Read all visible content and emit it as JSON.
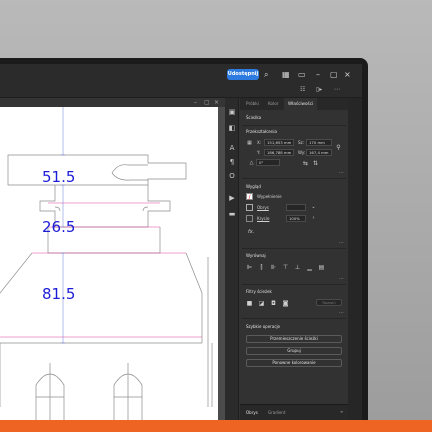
{
  "topbar": {
    "share_label": "Udostępnij",
    "search_icon": "search-icon",
    "layout_icon": "workspace-icon"
  },
  "panel": {
    "tabs": [
      "Próbki",
      "Kolor",
      "Właściwości"
    ],
    "selection": "Ścieżka",
    "transform": {
      "title": "Przekształcenia",
      "x_label": "X:",
      "x_value": "151,653 mm",
      "y_label": "Y:",
      "y_value": "186,788 mm",
      "w_label": "Sz:",
      "w_value": "170 mm",
      "h_label": "Wy:",
      "h_value": "167,4 mm",
      "angle_value": "0°"
    },
    "appearance": {
      "title": "Wygląd",
      "fill_label": "Wypełnienie",
      "stroke_label": "Obrys",
      "opacity_label": "Krycie",
      "opacity_value": "100%",
      "fx": "fx."
    },
    "align": {
      "title": "Wyrównaj"
    },
    "pathfinder": {
      "title": "Filtry ścieżek",
      "expand_label": "Rozwiń"
    },
    "quick_actions": {
      "title": "Szybkie operacje",
      "buttons": [
        "Przemieszczenie ścieżki",
        "Grupuj",
        "Ponowne kolorowanie"
      ]
    },
    "bottom_tabs": [
      "Obrys",
      "Gradient"
    ]
  },
  "canvas": {
    "dimensions": [
      "51.5",
      "26.5",
      "81.5"
    ]
  },
  "colors": {
    "accent": "#2d7be0",
    "dimension_text": "#1d1dd8",
    "dieline": "#8c8c8c",
    "banner": "#ee6422"
  }
}
